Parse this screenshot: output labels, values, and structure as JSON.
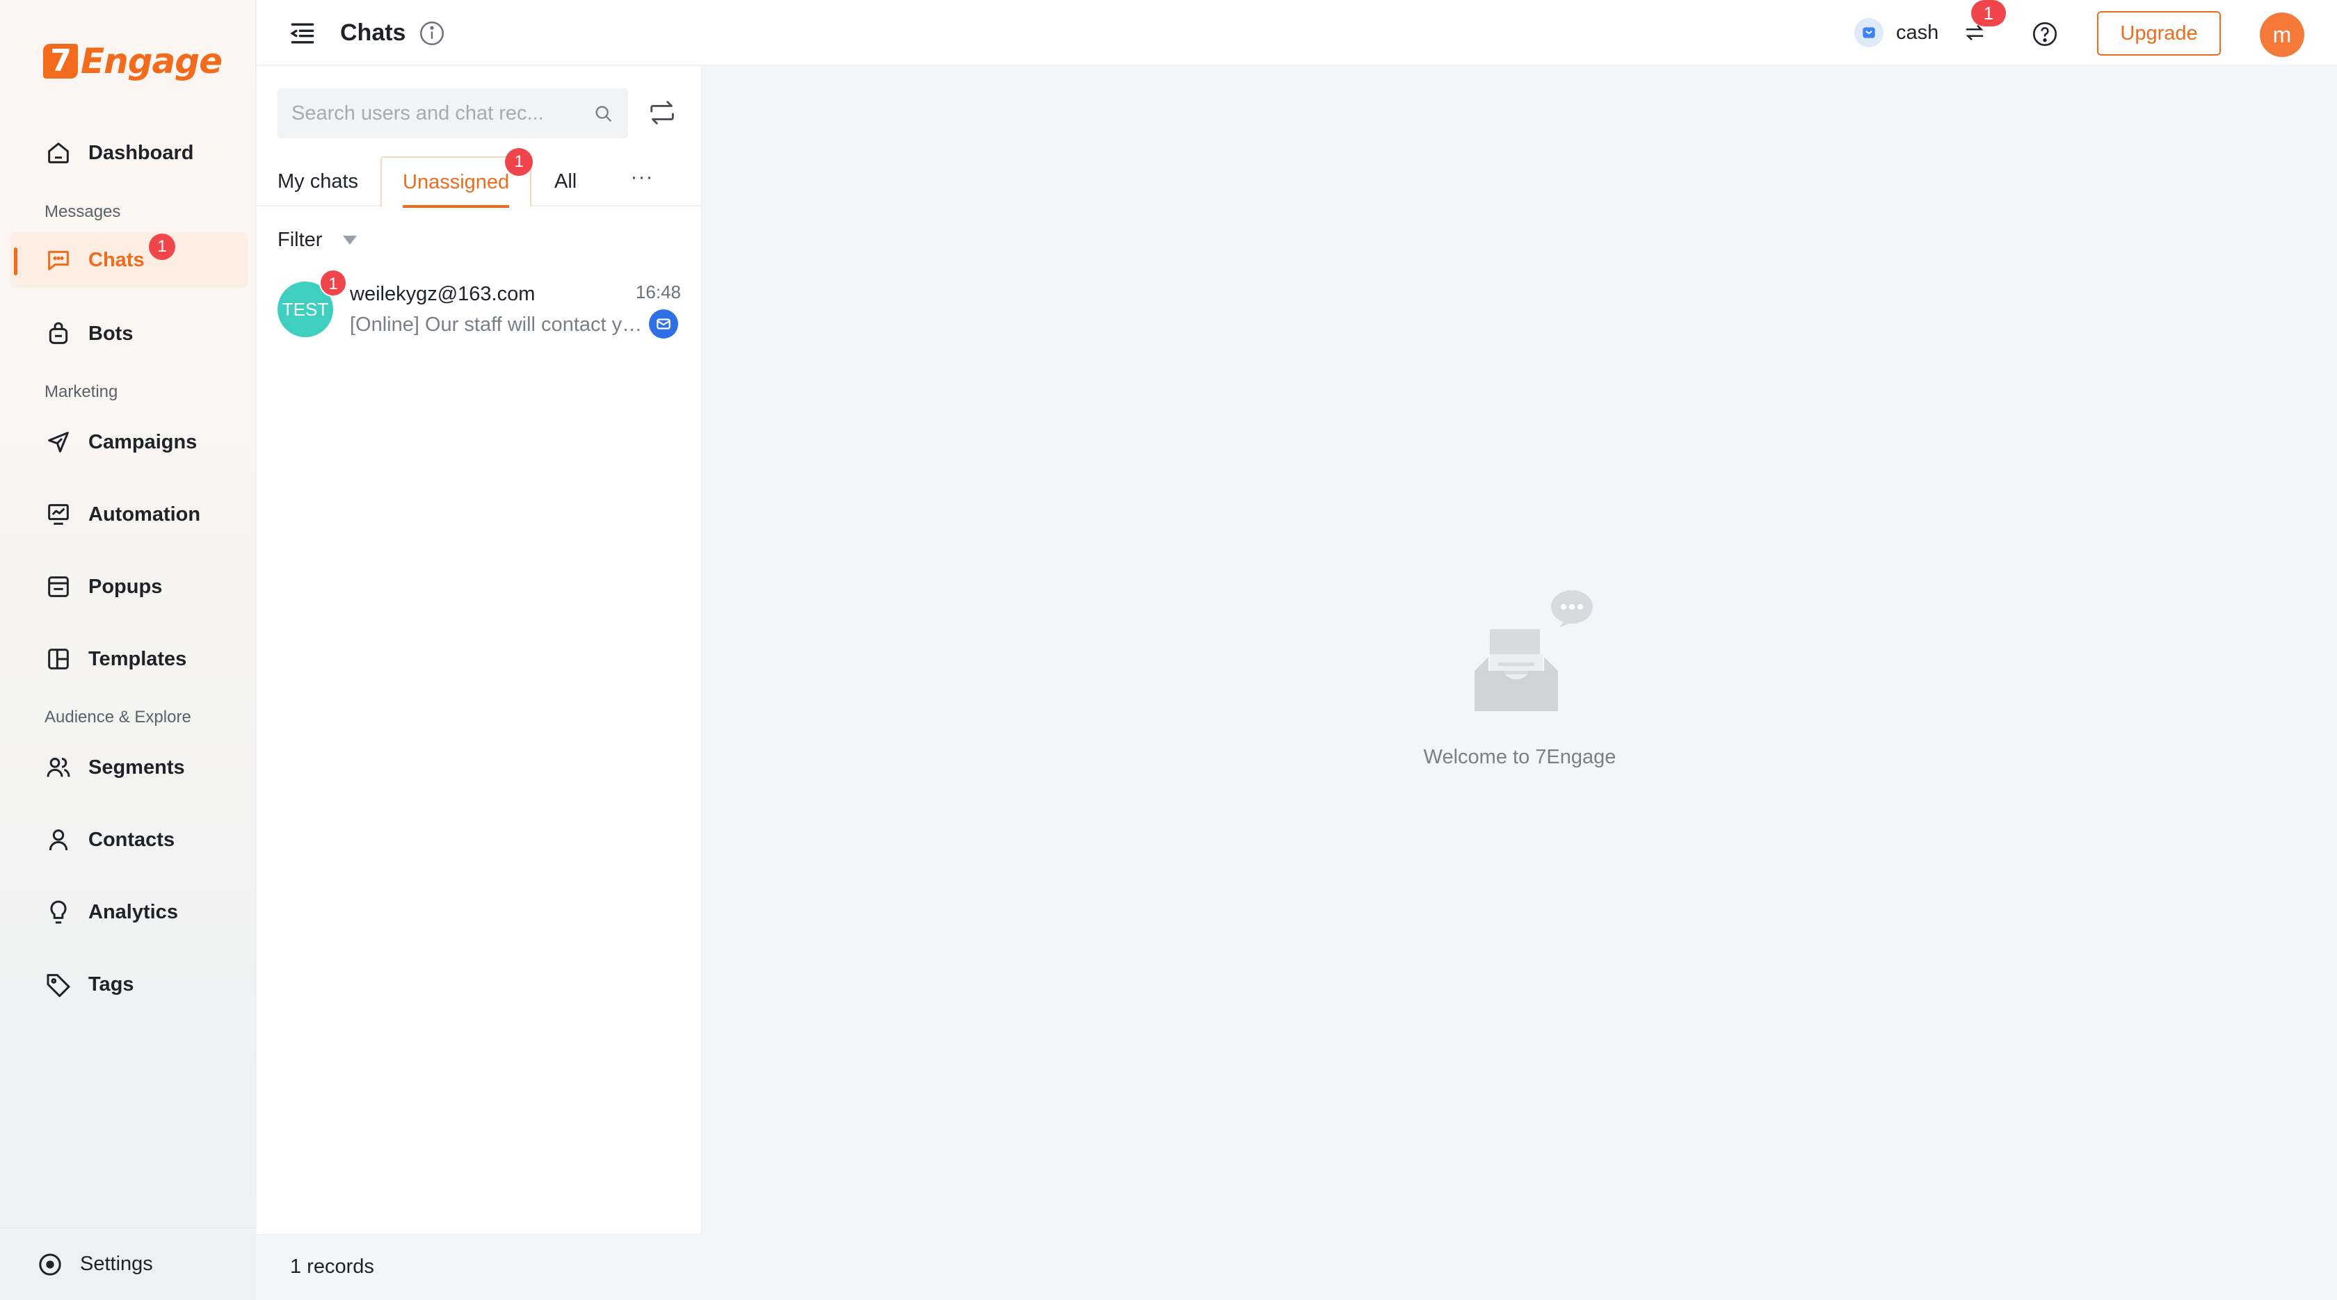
{
  "brand": {
    "logo_mark": "7",
    "logo_text": "Engage",
    "accent_color": "#f26b1d"
  },
  "sidebar": {
    "items": [
      {
        "label": "Dashboard",
        "icon": "home-icon"
      },
      {
        "label": "Chats",
        "icon": "chat-icon",
        "badge": "1",
        "active": true
      },
      {
        "label": "Bots",
        "icon": "bot-icon"
      },
      {
        "label": "Campaigns",
        "icon": "send-icon"
      },
      {
        "label": "Automation",
        "icon": "automation-icon"
      },
      {
        "label": "Popups",
        "icon": "popup-icon"
      },
      {
        "label": "Templates",
        "icon": "template-icon"
      },
      {
        "label": "Segments",
        "icon": "users-icon"
      },
      {
        "label": "Contacts",
        "icon": "user-icon"
      },
      {
        "label": "Analytics",
        "icon": "bulb-icon"
      },
      {
        "label": "Tags",
        "icon": "tag-icon"
      }
    ],
    "sections": [
      "Messages",
      "Marketing",
      "Audience & Explore"
    ],
    "settings_label": "Settings"
  },
  "header": {
    "title": "Chats",
    "store_name": "cash",
    "switch_badge": "1",
    "upgrade_label": "Upgrade",
    "avatar_initial": "m"
  },
  "chat_list": {
    "search_placeholder": "Search users and chat rec...",
    "tabs": [
      {
        "label": "My chats"
      },
      {
        "label": "Unassigned",
        "badge": "1",
        "active": true
      },
      {
        "label": "All"
      }
    ],
    "more_label": "···",
    "filter_label": "Filter",
    "items": [
      {
        "avatar_text": "TEST",
        "unread": "1",
        "name": "weilekygz@163.com",
        "time": "16:48",
        "preview": "[Online] Our staff will contact you shortly",
        "channel": "email-icon"
      }
    ],
    "records_label": "1 records"
  },
  "main": {
    "welcome_text": "Welcome to 7Engage"
  }
}
